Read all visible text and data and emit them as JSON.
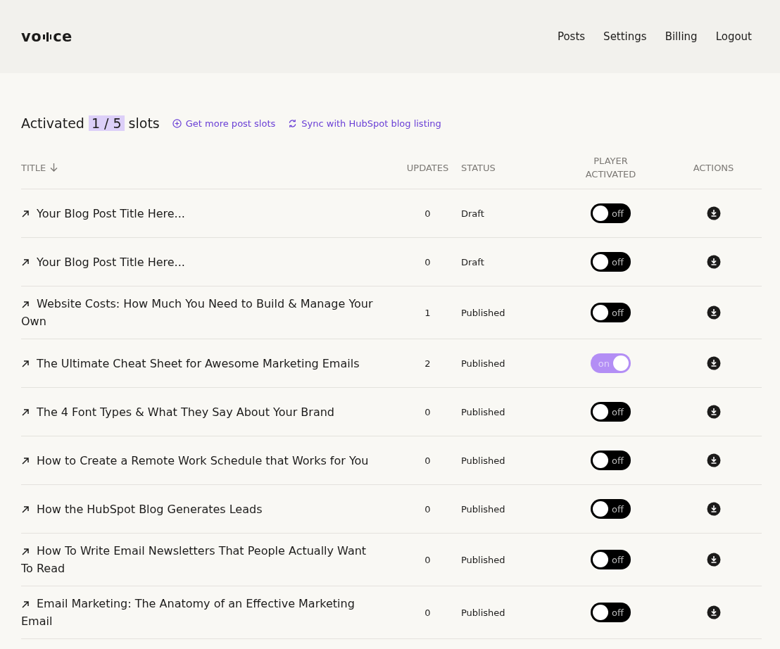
{
  "header": {
    "logo": {
      "before": "vo",
      "after": "ce"
    },
    "nav": [
      {
        "label": "Posts"
      },
      {
        "label": "Settings"
      },
      {
        "label": "Billing"
      },
      {
        "label": "Logout"
      }
    ]
  },
  "summary": {
    "prefix": "Activated",
    "count": "1 / 5",
    "suffix": "slots",
    "links": [
      {
        "kind": "add",
        "label": "Get more post slots"
      },
      {
        "kind": "sync",
        "label": "Sync with HubSpot blog listing"
      }
    ]
  },
  "table": {
    "columns": [
      {
        "label": "TITLE",
        "sorted": true
      },
      {
        "label": "UPDATES",
        "sorted": false
      },
      {
        "label": "STATUS",
        "sorted": false
      },
      {
        "label": "PLAYER ACTIVATED",
        "sorted": false
      },
      {
        "label": "ACTIONS",
        "sorted": false
      }
    ],
    "rows": [
      {
        "title": "Your Blog Post Title Here...",
        "updates": "0",
        "status": "Draft",
        "player": {
          "on": false,
          "label": "off"
        }
      },
      {
        "title": "Your Blog Post Title Here...",
        "updates": "0",
        "status": "Draft",
        "player": {
          "on": false,
          "label": "off"
        }
      },
      {
        "title": "Website Costs: How Much You Need to Build & Manage Your Own",
        "updates": "1",
        "status": "Published",
        "player": {
          "on": false,
          "label": "off"
        }
      },
      {
        "title": "The Ultimate Cheat Sheet for Awesome Marketing Emails",
        "updates": "2",
        "status": "Published",
        "player": {
          "on": true,
          "label": "on"
        }
      },
      {
        "title": "The 4 Font Types & What They Say About Your Brand",
        "updates": "0",
        "status": "Published",
        "player": {
          "on": false,
          "label": "off"
        }
      },
      {
        "title": "How to Create a Remote Work Schedule that Works for You",
        "updates": "0",
        "status": "Published",
        "player": {
          "on": false,
          "label": "off"
        }
      },
      {
        "title": "How the HubSpot Blog Generates Leads",
        "updates": "0",
        "status": "Published",
        "player": {
          "on": false,
          "label": "off"
        }
      },
      {
        "title": "How To Write Email Newsletters That People Actually Want To Read",
        "updates": "0",
        "status": "Published",
        "player": {
          "on": false,
          "label": "off"
        }
      },
      {
        "title": "Email Marketing: The Anatomy of an Effective Marketing Email",
        "updates": "0",
        "status": "Published",
        "player": {
          "on": false,
          "label": "off"
        }
      }
    ]
  }
}
